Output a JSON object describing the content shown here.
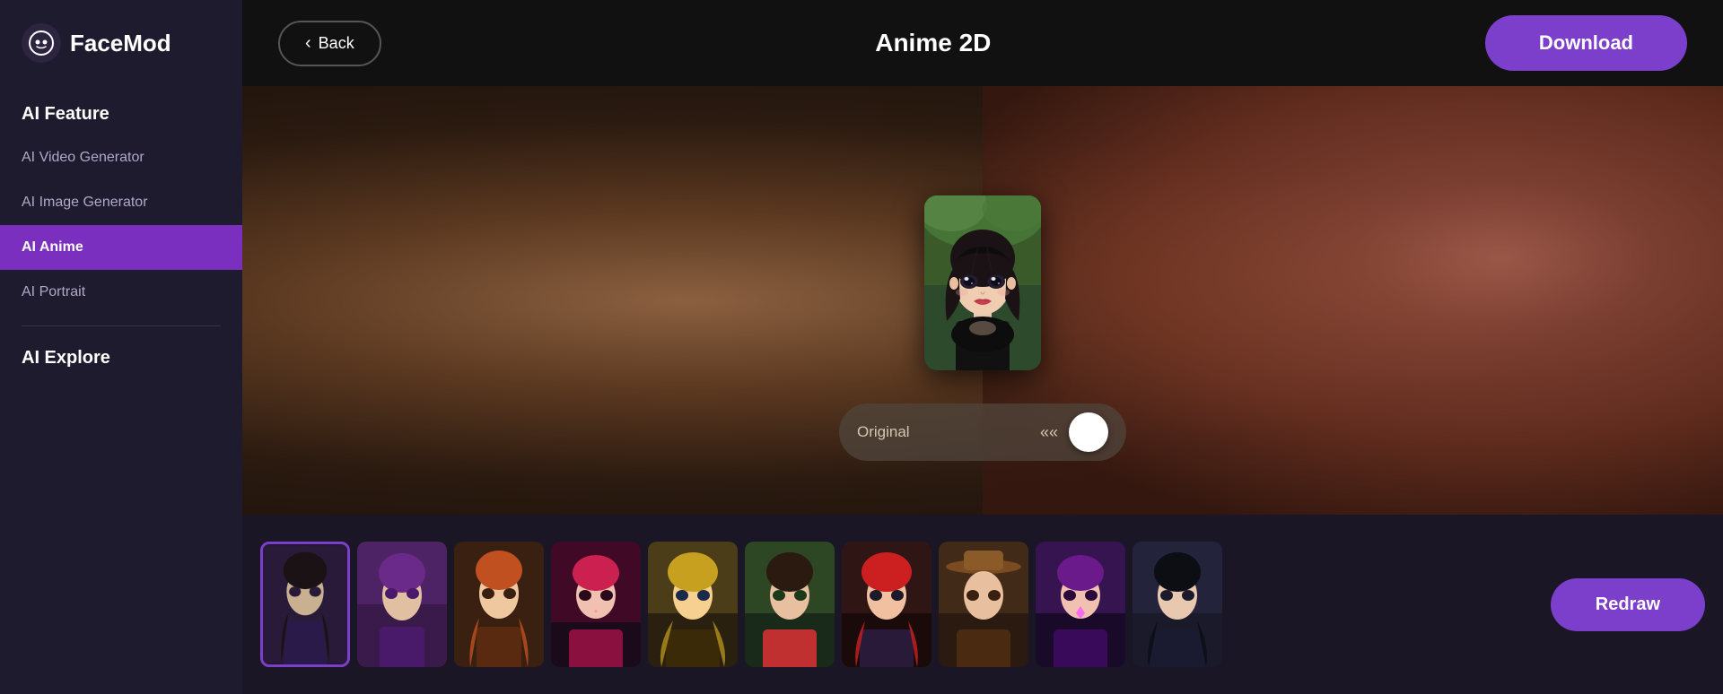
{
  "logo": {
    "icon": "😶",
    "text": "FaceMod"
  },
  "sidebar": {
    "feature_section": "AI Feature",
    "explore_section": "AI Explore",
    "items": [
      {
        "id": "ai-video-generator",
        "label": "AI Video Generator",
        "active": false
      },
      {
        "id": "ai-image-generator",
        "label": "AI Image Generator",
        "active": false
      },
      {
        "id": "ai-anime",
        "label": "AI Anime",
        "active": true
      },
      {
        "id": "ai-portrait",
        "label": "AI Portrait",
        "active": false
      }
    ]
  },
  "header": {
    "back_label": "Back",
    "title": "Anime 2D",
    "download_label": "Download"
  },
  "toggle": {
    "label": "Original"
  },
  "bottom": {
    "redraw_label": "Redraw"
  },
  "thumbnails": [
    {
      "id": 1,
      "colors": [
        "#3a2a4a",
        "#6a4a7a",
        "#2a1a3a"
      ],
      "selected": true
    },
    {
      "id": 2,
      "colors": [
        "#4a2a6a",
        "#9a5aaa",
        "#2a1a4a"
      ],
      "selected": false
    },
    {
      "id": 3,
      "colors": [
        "#7a3a2a",
        "#c06a4a",
        "#4a2a1a"
      ],
      "selected": false
    },
    {
      "id": 4,
      "colors": [
        "#8a2a4a",
        "#cc4a6a",
        "#3a1a2a"
      ],
      "selected": false
    },
    {
      "id": 5,
      "colors": [
        "#8a7a3a",
        "#c8b050",
        "#4a4a1a"
      ],
      "selected": false
    },
    {
      "id": 6,
      "colors": [
        "#3a4a3a",
        "#5a7a5a",
        "#1a2a1a"
      ],
      "selected": false
    },
    {
      "id": 7,
      "colors": [
        "#6a2a2a",
        "#aa4a4a",
        "#2a1a1a"
      ],
      "selected": false
    },
    {
      "id": 8,
      "colors": [
        "#7a4a2a",
        "#aa6a3a",
        "#4a2a1a"
      ],
      "selected": false
    },
    {
      "id": 9,
      "colors": [
        "#6a2a6a",
        "#aa4aaa",
        "#2a1a3a"
      ],
      "selected": false
    },
    {
      "id": 10,
      "colors": [
        "#2a2a3a",
        "#4a4a6a",
        "#1a1a2a"
      ],
      "selected": false
    }
  ]
}
